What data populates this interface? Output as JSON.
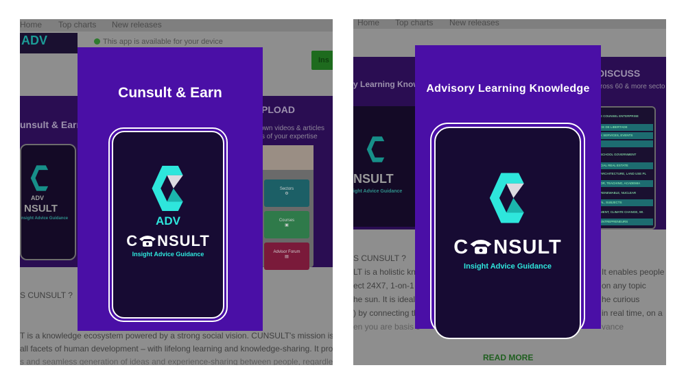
{
  "nav": {
    "home": "Home",
    "top_charts": "Top charts",
    "new_releases": "New releases"
  },
  "left": {
    "header_logo": "ADV",
    "availability": "This app is available for your device",
    "install_label": "Ins",
    "banner_left": "unsult & Earn",
    "banner_right": "PLOAD",
    "banner_right_sub1": "r own videos & articles",
    "banner_right_sub2": "s of your expertise",
    "mini_adv": "ADV",
    "mini_word": "NSULT",
    "mini_tag": "nsight Advice Guidance",
    "tiles": [
      {
        "label": "Sectors",
        "icon": "⚙"
      },
      {
        "label": "Courses",
        "icon": "▣"
      },
      {
        "label": "Advisor Forum",
        "icon": "▤"
      }
    ],
    "section_heading": "S CUNSULT ?",
    "desc1": "T is a knowledge ecosystem powered by a strong social vision. CUNSULT's mission is to",
    "desc2": "all facets of human development – with lifelong learning and knowledge-sharing. It promo",
    "desc3": "s and seamless generation of ideas and experience-sharing between people, regardless o",
    "card_title": "Cunsult & Earn",
    "logo_adv": "ADV",
    "logo_word_pre": "C",
    "logo_word_post": "NSULT",
    "logo_tag": "Insight Advice Guidance"
  },
  "right": {
    "banner_left": "y Learning Know",
    "banner_right": "DISCUSS",
    "banner_right_sub": "ross 60 & more secto",
    "mini_word": "NSULT",
    "mini_tag": "ight Advice Guidance",
    "menu": [
      "E COUNSEL ENTERPRISE",
      "CE DE LIBERTADE",
      "K SERVICES, EVENTS",
      "",
      "SCHOOL GOVERNMENT",
      "CIAL REAL ESTATE",
      "ARCHITECTURE, LAND USE PL",
      "OR, TEACHING, ACADEMIA",
      "RENEWABLE, NUCLEAR",
      "AL, SUBJECTS",
      "MENT, CLIMATE CHANGE, WI.",
      "ENTREPRENEURS"
    ],
    "section_heading": "S CUNSULT ?",
    "left_lines": [
      "LT is a holistic kno",
      "ect 24X7, 1-on-1 v",
      "he sun. It is ideal f",
      ") by connecting th",
      "en you are basis s"
    ],
    "right_lines": [
      "It enables people",
      "on any topic",
      "he curious",
      "in real time, on a",
      "vance"
    ],
    "read_more": "READ MORE",
    "card_title": "Advisory Learning Knowledge",
    "logo_word_pre": "C",
    "logo_word_post": "NSULT",
    "logo_tag": "Insight Advice Guidance"
  },
  "colors": {
    "card_purple": "#4a0fa6",
    "phone_dark": "#170b33",
    "accent_cyan": "#2ee6dc"
  }
}
